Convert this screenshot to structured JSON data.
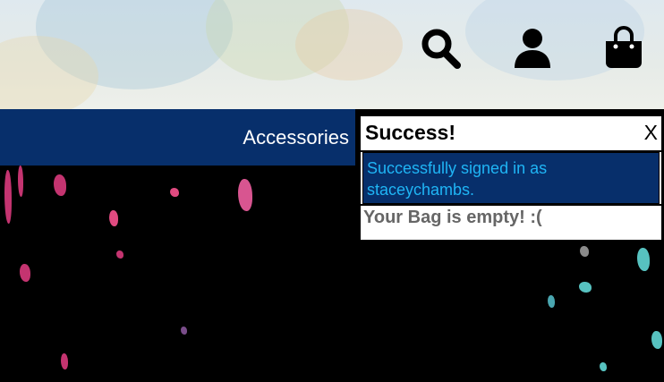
{
  "header": {
    "icons": [
      "search-icon",
      "user-icon",
      "shopping-bag-icon"
    ]
  },
  "nav": {
    "accessories_label": "Accessories"
  },
  "toast": {
    "title": "Success!",
    "close_label": "X",
    "message": "Successfully signed in as staceychambs.",
    "bag_status": "Your Bag is empty! :("
  },
  "colors": {
    "navy": "#072f6b",
    "message_text": "#1fb5f5",
    "bag_text": "#666666"
  }
}
